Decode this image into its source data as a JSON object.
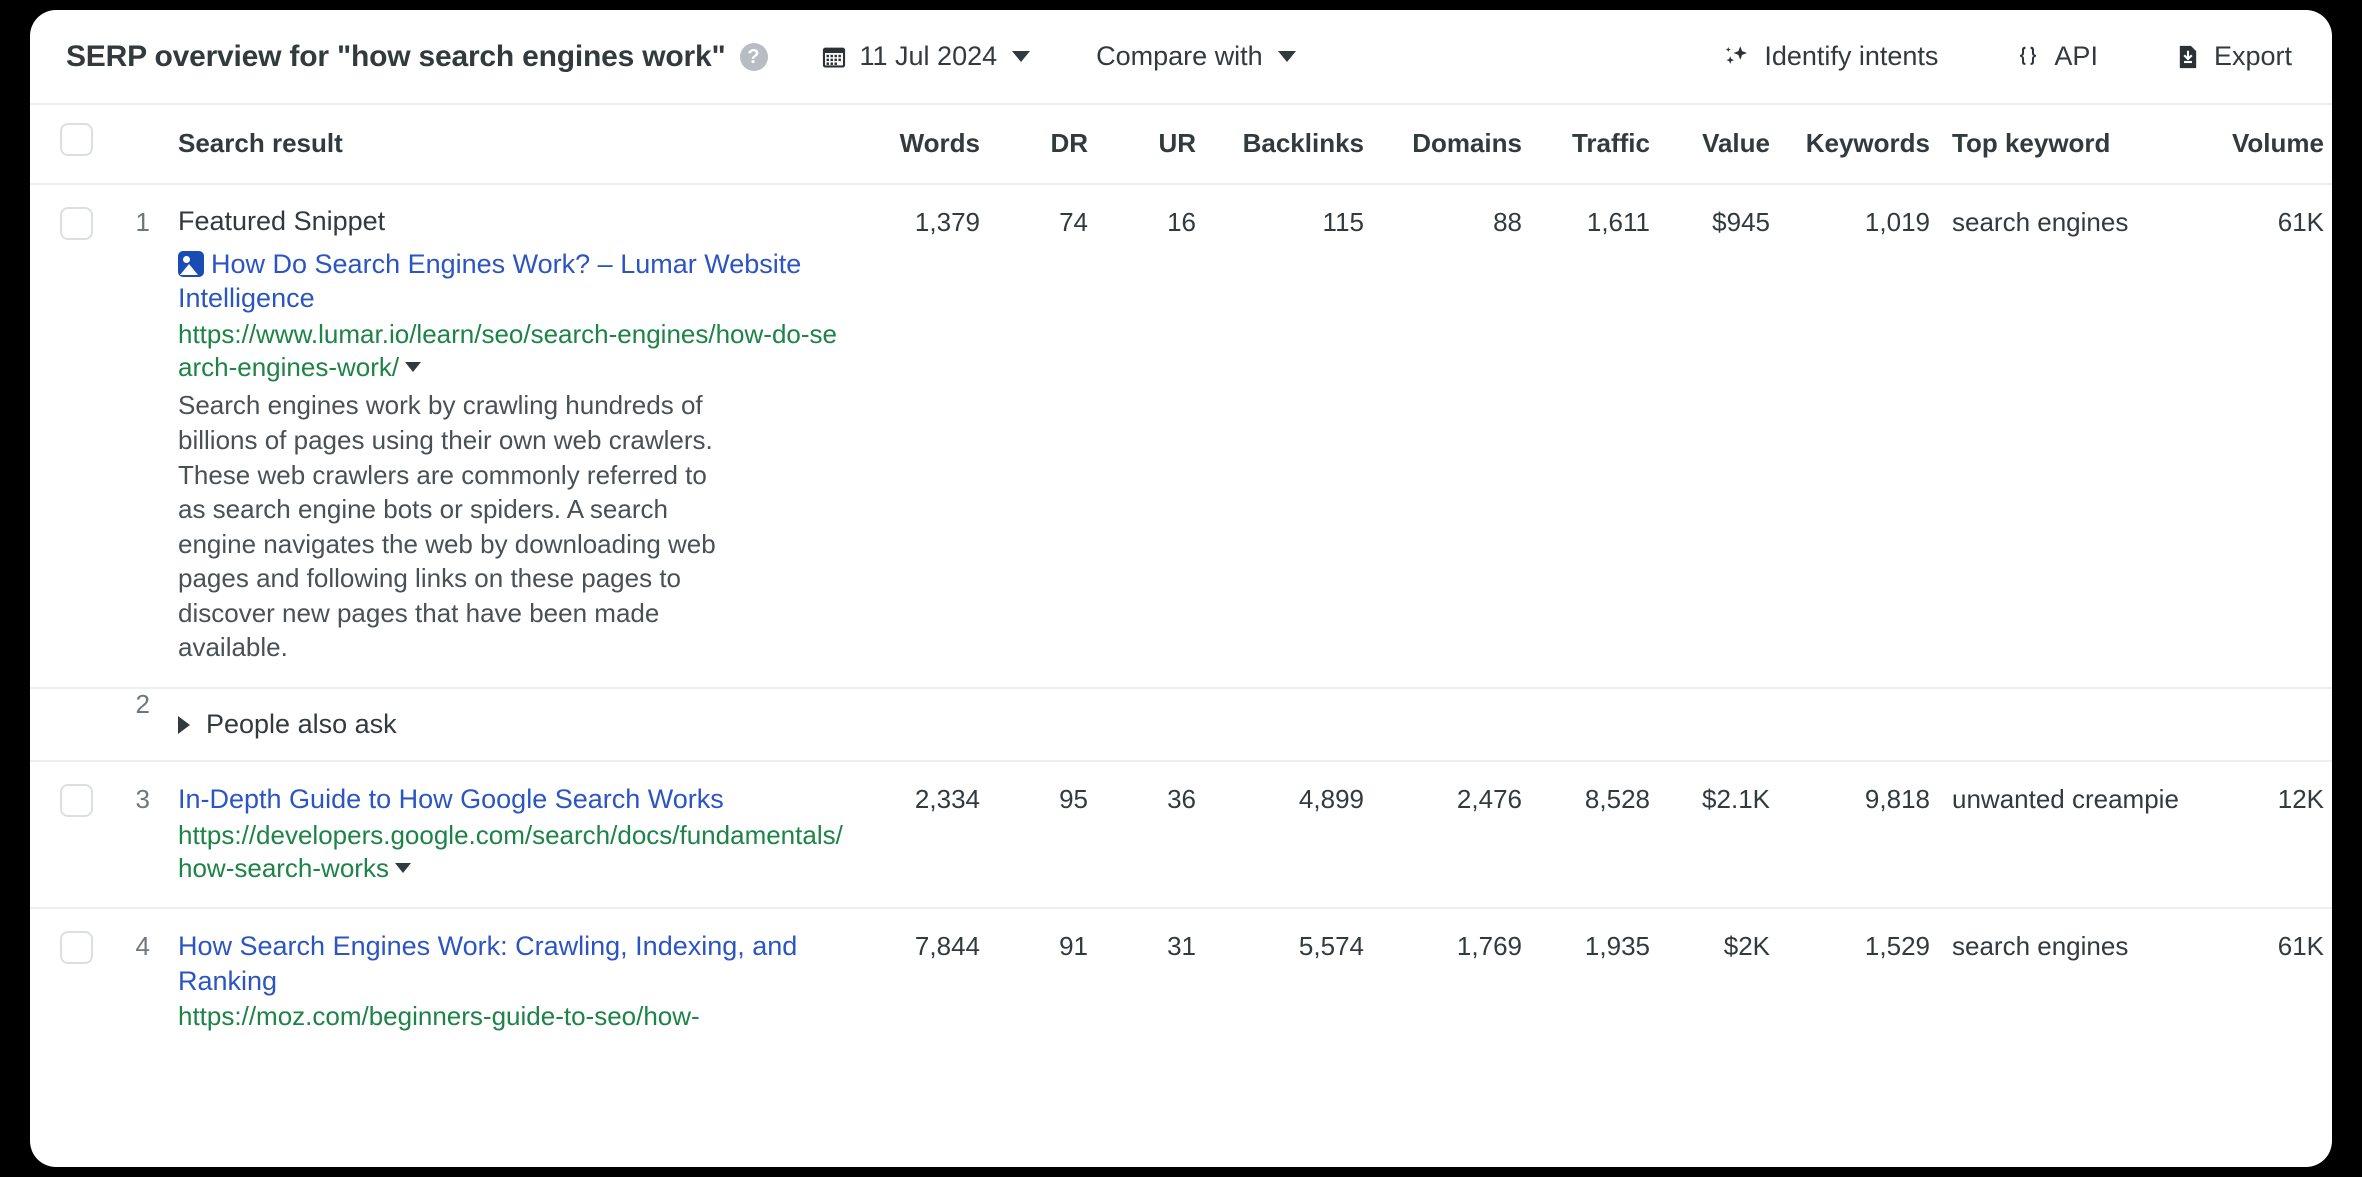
{
  "header": {
    "title": "SERP overview for \"how search engines work\"",
    "help_icon": "help-circle-icon",
    "date_label": "11 Jul 2024",
    "calendar_icon": "calendar-icon",
    "compare_label": "Compare with",
    "identify_intents_label": "Identify intents",
    "identify_intents_icon": "sparkles-icon",
    "api_label": "API",
    "api_icon": "braces-icon",
    "export_label": "Export",
    "export_icon": "download-file-icon"
  },
  "table": {
    "columns": [
      {
        "key": "search_result",
        "label": "Search result"
      },
      {
        "key": "words",
        "label": "Words"
      },
      {
        "key": "dr",
        "label": "DR"
      },
      {
        "key": "ur",
        "label": "UR"
      },
      {
        "key": "backlinks",
        "label": "Backlinks"
      },
      {
        "key": "domains",
        "label": "Domains"
      },
      {
        "key": "traffic",
        "label": "Traffic"
      },
      {
        "key": "value",
        "label": "Value"
      },
      {
        "key": "keywords",
        "label": "Keywords"
      },
      {
        "key": "top_keyword",
        "label": "Top keyword"
      },
      {
        "key": "volume",
        "label": "Volume"
      }
    ],
    "rows": [
      {
        "position": "1",
        "type": "featured_snippet",
        "snippet_label": "Featured Snippet",
        "title": "How Do Search Engines Work? – Lumar Website Intelligence",
        "title_badge": "image-result-icon",
        "url": "https://www.lumar.io/learn/seo/search-engines/how-do-search-engines-work/",
        "description": "Search engines work by crawling hundreds of billions of pages using their own web crawlers. These web crawlers are commonly referred to as search engine bots or spiders. A search engine navigates the web by downloading web pages and following links on these pages to discover new pages that have been made available.",
        "words": "1,379",
        "dr": "74",
        "ur": "16",
        "backlinks": "115",
        "domains": "88",
        "traffic": "1,611",
        "value": "$945",
        "keywords": "1,019",
        "top_keyword": "search engines",
        "volume": "61K"
      },
      {
        "position": "2",
        "type": "people_also_ask",
        "label": "People also ask"
      },
      {
        "position": "3",
        "type": "organic",
        "title": "In-Depth Guide to How Google Search Works",
        "url": "https://developers.google.com/search/docs/fundamentals/how-search-works",
        "words": "2,334",
        "dr": "95",
        "ur": "36",
        "backlinks": "4,899",
        "domains": "2,476",
        "traffic": "8,528",
        "value": "$2.1K",
        "keywords": "9,818",
        "top_keyword": "unwanted creampie",
        "volume": "12K"
      },
      {
        "position": "4",
        "type": "organic",
        "title": "How Search Engines Work: Crawling, Indexing, and Ranking",
        "url": "https://moz.com/beginners-guide-to-seo/how-",
        "words": "7,844",
        "dr": "91",
        "ur": "31",
        "backlinks": "5,574",
        "domains": "1,769",
        "traffic": "1,935",
        "value": "$2K",
        "keywords": "1,529",
        "top_keyword": "search engines",
        "volume": "61K"
      }
    ]
  },
  "colors": {
    "link_blue": "#2c55c4",
    "url_green": "#1e8347",
    "text_dark": "#333a3e",
    "border": "#eceef0",
    "badge_blue": "#1a4db3",
    "page_background": "#000000"
  }
}
